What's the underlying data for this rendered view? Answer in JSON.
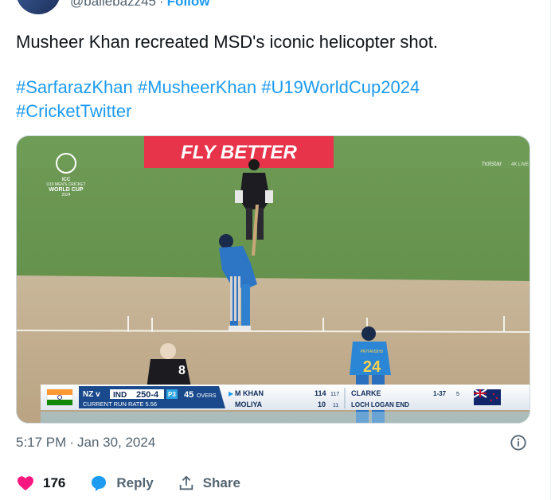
{
  "header": {
    "handle": "@ballebazz45",
    "separator": "·",
    "follow_label": "Follow"
  },
  "tweet": {
    "text": "Musheer Khan recreated MSD's iconic helicopter shot.",
    "hashtags": [
      "#SarfarazKhan",
      "#MusheerKhan",
      "#U19WorldCup2024",
      "#CricketTwitter"
    ]
  },
  "media": {
    "banner": "FLY BETTER",
    "logo": {
      "l1": "ICC",
      "l2": "U19 MEN'S CRICKET",
      "l3": "WORLD CUP",
      "l4": "2024"
    },
    "broadcaster": {
      "name": "hotstar",
      "tag": "4K LIVE"
    },
    "jerseys": {
      "batter_back": "8",
      "fielder_name": "PRIYANSHU",
      "fielder_number": "24"
    },
    "scorebar": {
      "team_a": "NZ v",
      "team_b": "IND",
      "score": "250-4",
      "powerplay": "P3",
      "overs": "45",
      "overs_unit": "OVERS",
      "run_rate_label": "CURRENT RUN RATE 5.56",
      "batter1_name": "M KHAN",
      "batter1_runs": "114",
      "batter1_balls": "117",
      "batter2_name": "MOLIYA",
      "batter2_runs": "10",
      "batter2_balls": "11",
      "bowler_name": "CLARKE",
      "bowler_figures": "1-37",
      "bowler_overs": "5",
      "end_label": "LOCH LOGAN END"
    }
  },
  "meta": {
    "time": "5:17 PM",
    "separator": "·",
    "date": "Jan 30, 2024"
  },
  "actions": {
    "likes": "176",
    "reply_label": "Reply",
    "share_label": "Share"
  },
  "colors": {
    "accent": "#1d9bf0",
    "like": "#f91880",
    "muted": "#536471"
  }
}
